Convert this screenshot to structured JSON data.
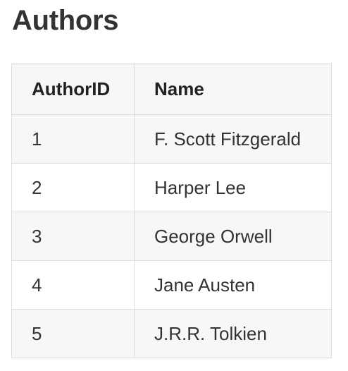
{
  "title": "Authors",
  "table": {
    "columns": [
      "AuthorID",
      "Name"
    ],
    "rows": [
      {
        "id": "1",
        "name": "F. Scott Fitzgerald"
      },
      {
        "id": "2",
        "name": "Harper Lee"
      },
      {
        "id": "3",
        "name": "George Orwell"
      },
      {
        "id": "4",
        "name": "Jane Austen"
      },
      {
        "id": "5",
        "name": "J.R.R. Tolkien"
      }
    ]
  },
  "colors": {
    "text": "#333333",
    "border": "#dcdcdc",
    "stripe": "#f7f7f7"
  }
}
